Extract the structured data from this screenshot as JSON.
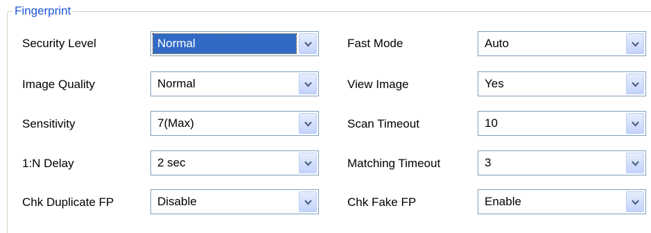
{
  "group_title": "Fingerprint",
  "left": [
    {
      "label": "Security Level",
      "value": "Normal",
      "focused": true
    },
    {
      "label": "Image Quality",
      "value": "Normal",
      "focused": false
    },
    {
      "label": "Sensitivity",
      "value": "7(Max)",
      "focused": false
    },
    {
      "label": "1:N Delay",
      "value": "2 sec",
      "focused": false
    },
    {
      "label": "Chk Duplicate FP",
      "value": "Disable",
      "focused": false
    }
  ],
  "right": [
    {
      "label": "Fast Mode",
      "value": "Auto",
      "focused": false
    },
    {
      "label": "View Image",
      "value": "Yes",
      "focused": false
    },
    {
      "label": "Scan Timeout",
      "value": "10",
      "focused": false
    },
    {
      "label": "Matching Timeout",
      "value": "3",
      "focused": false
    },
    {
      "label": "Chk Fake FP",
      "value": "Enable",
      "focused": false
    }
  ]
}
